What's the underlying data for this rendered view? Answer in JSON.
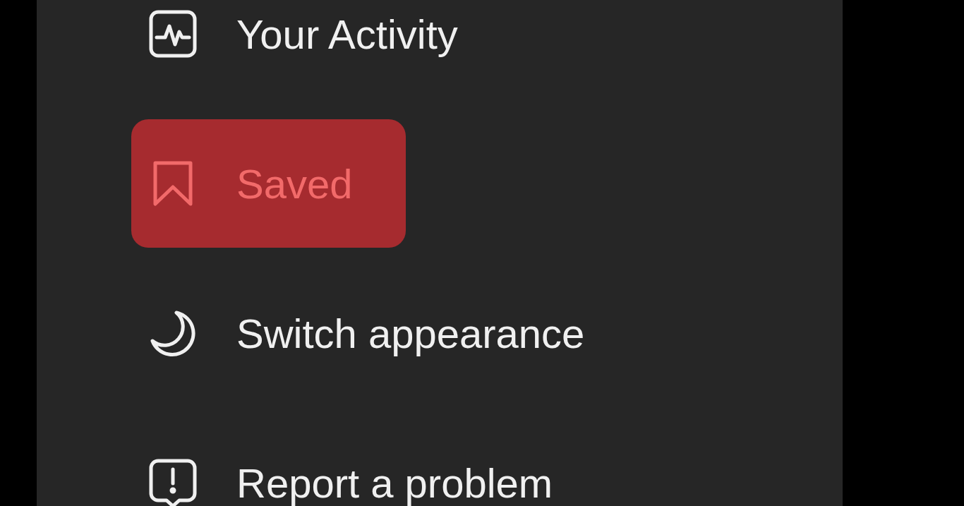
{
  "menu": {
    "items": [
      {
        "kind": "activity",
        "label": "Your Activity",
        "selected": false
      },
      {
        "kind": "saved",
        "label": "Saved",
        "selected": true
      },
      {
        "kind": "appearance",
        "label": "Switch appearance",
        "selected": false
      },
      {
        "kind": "report",
        "label": "Report a problem",
        "selected": false
      }
    ]
  }
}
